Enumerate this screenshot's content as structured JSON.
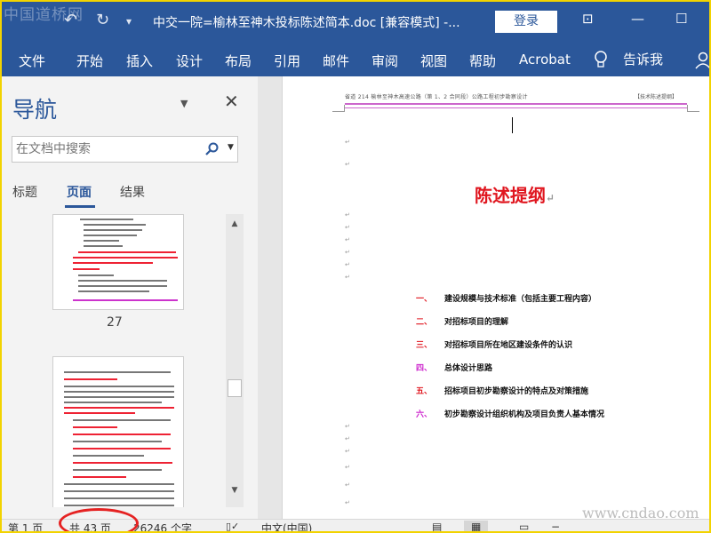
{
  "watermark_top": "中国道桥网",
  "title": "中交一院=榆林至神木投标陈述简本.doc [兼容模式]  -...",
  "login_label": "登录",
  "ribbon_tabs": [
    "文件",
    "开始",
    "插入",
    "设计",
    "布局",
    "引用",
    "邮件",
    "审阅",
    "视图",
    "帮助",
    "Acrobat"
  ],
  "tell_me": "告诉我",
  "nav": {
    "title": "导航",
    "search_placeholder": "在文档中搜索",
    "tabs": [
      "标题",
      "页面",
      "结果"
    ],
    "active_tab": "页面",
    "page_thumb_number": "27"
  },
  "doc": {
    "header_text": "省道 214 榆林至神木高速公路（第 1、2 合同段）公路工程初步勘察设计",
    "header_right": "【技术陈述提纲】",
    "heading": "陈述提纲",
    "toc": [
      {
        "num": "一、",
        "text": "建设规模与技术标准（包括主要工程内容）"
      },
      {
        "num": "二、",
        "text": "对招标项目的理解"
      },
      {
        "num": "三、",
        "text": "对招标项目所在地区建设条件的认识"
      },
      {
        "num": "四、",
        "text": "总体设计思路"
      },
      {
        "num": "五、",
        "text": "招标项目初步勘察设计的特点及对策措施"
      },
      {
        "num": "六、",
        "text": "初步勘察设计组织机构及项目负责人基本情况"
      }
    ]
  },
  "status": {
    "page": "第 1 页",
    "total": "共 43 页",
    "words": "26246 个字",
    "language": "中文(中国)"
  },
  "watermark_bottom": "www.cndao.com",
  "colors": {
    "accent": "#2b579a",
    "heading": "#e0161f",
    "magenta": "#cc22cc",
    "highlight": "#e52222"
  }
}
